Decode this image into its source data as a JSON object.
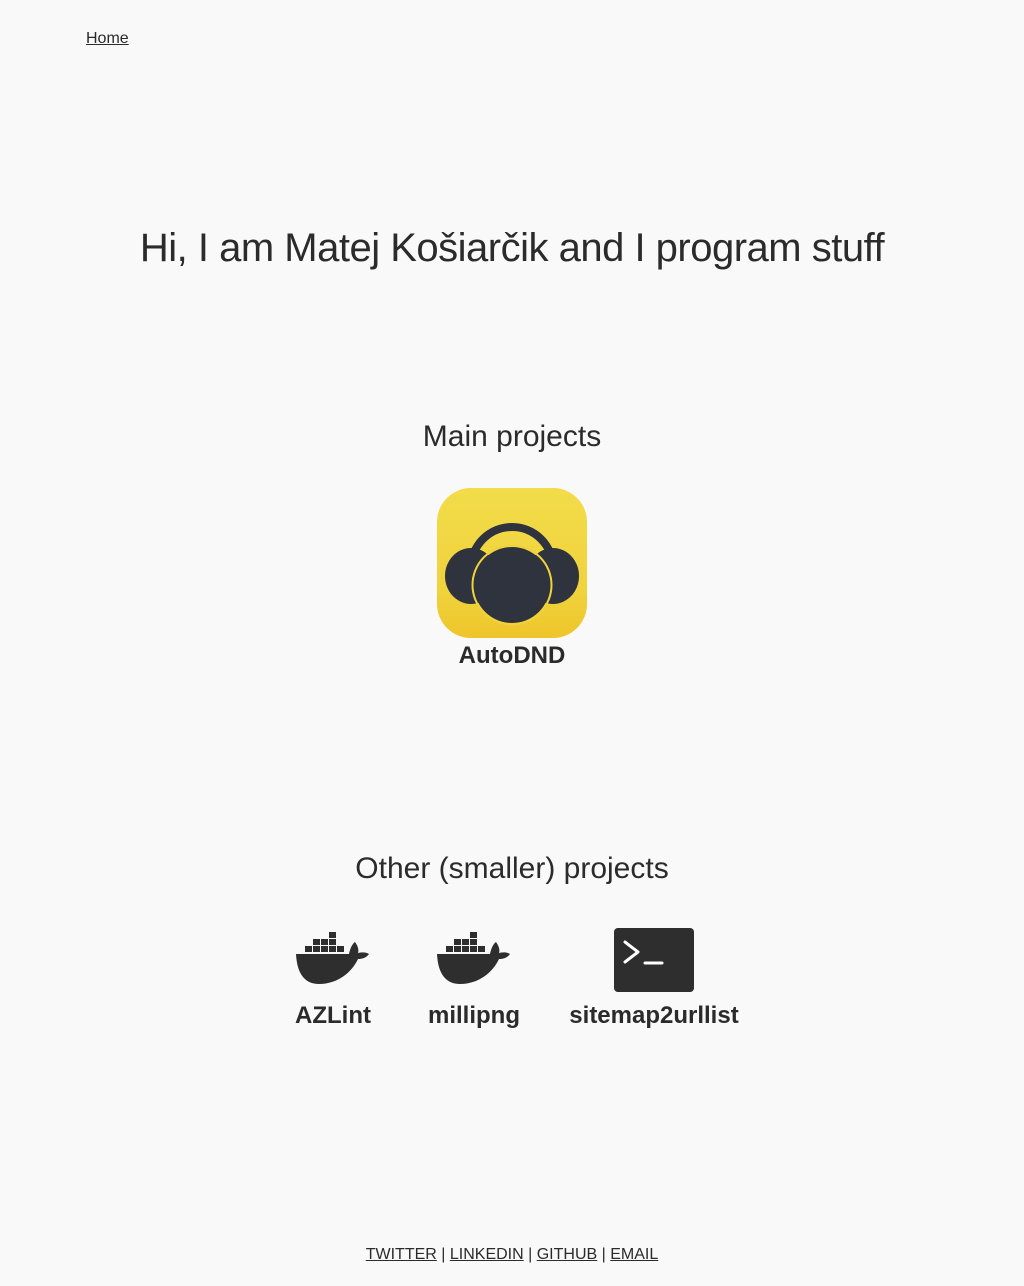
{
  "nav": {
    "home_label": "Home"
  },
  "hero": {
    "title": "Hi, I am Matej Košiarčik and I program stuff"
  },
  "main_projects": {
    "title": "Main projects",
    "items": [
      {
        "label": "AutoDND",
        "icon": "headphones-icon",
        "icon_color": "#f0d23c"
      }
    ]
  },
  "other_projects": {
    "title": "Other (smaller) projects",
    "items": [
      {
        "label": "AZLint",
        "icon": "docker-whale-icon"
      },
      {
        "label": "millipng",
        "icon": "docker-whale-icon"
      },
      {
        "label": "sitemap2urllist",
        "icon": "terminal-icon"
      }
    ]
  },
  "footer": {
    "links": [
      "TWITTER",
      "LINKEDIN",
      "GITHUB",
      "EMAIL"
    ],
    "separator": "|"
  },
  "colors": {
    "background": "#f9f9f9",
    "text": "#2b2b2b",
    "icon_dark": "#2e333d",
    "autodnd_yellow": "#f0d23c"
  }
}
